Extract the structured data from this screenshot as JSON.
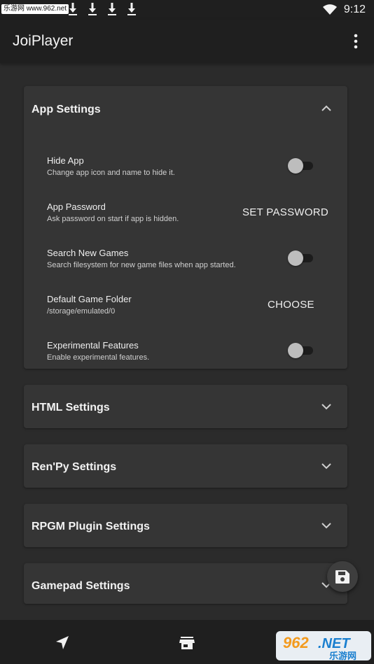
{
  "status_bar": {
    "site_tag": "乐游网 www.962.net",
    "time": "9:12"
  },
  "app_bar": {
    "title": "JoiPlayer"
  },
  "app_settings": {
    "title": "App Settings",
    "items": [
      {
        "title": "Hide App",
        "subtitle": "Change app icon and name to hide it.",
        "enabled": false
      },
      {
        "title": "App Password",
        "subtitle": "Ask password on start if app is hidden.",
        "action": "SET PASSWORD"
      },
      {
        "title": "Search New Games",
        "subtitle": "Search filesystem for new game files when app started.",
        "enabled": false
      },
      {
        "title": "Default Game Folder",
        "subtitle": "/storage/emulated/0",
        "action": "CHOOSE"
      },
      {
        "title": "Experimental Features",
        "subtitle": "Enable experimental features.",
        "enabled": false
      }
    ]
  },
  "sections": [
    {
      "title": "HTML Settings"
    },
    {
      "title": "Ren'Py Settings"
    },
    {
      "title": "RPGM Plugin Settings"
    },
    {
      "title": "Gamepad Settings"
    }
  ],
  "watermark": {
    "brand": "962.NET",
    "cn": "乐游网"
  },
  "icons": {
    "overflow": "more-vert-icon",
    "expand": "chevron-down-icon",
    "collapse": "chevron-up-icon",
    "fab": "save-icon",
    "nav_left": "navigation-arrow-icon",
    "nav_center": "store-icon"
  }
}
